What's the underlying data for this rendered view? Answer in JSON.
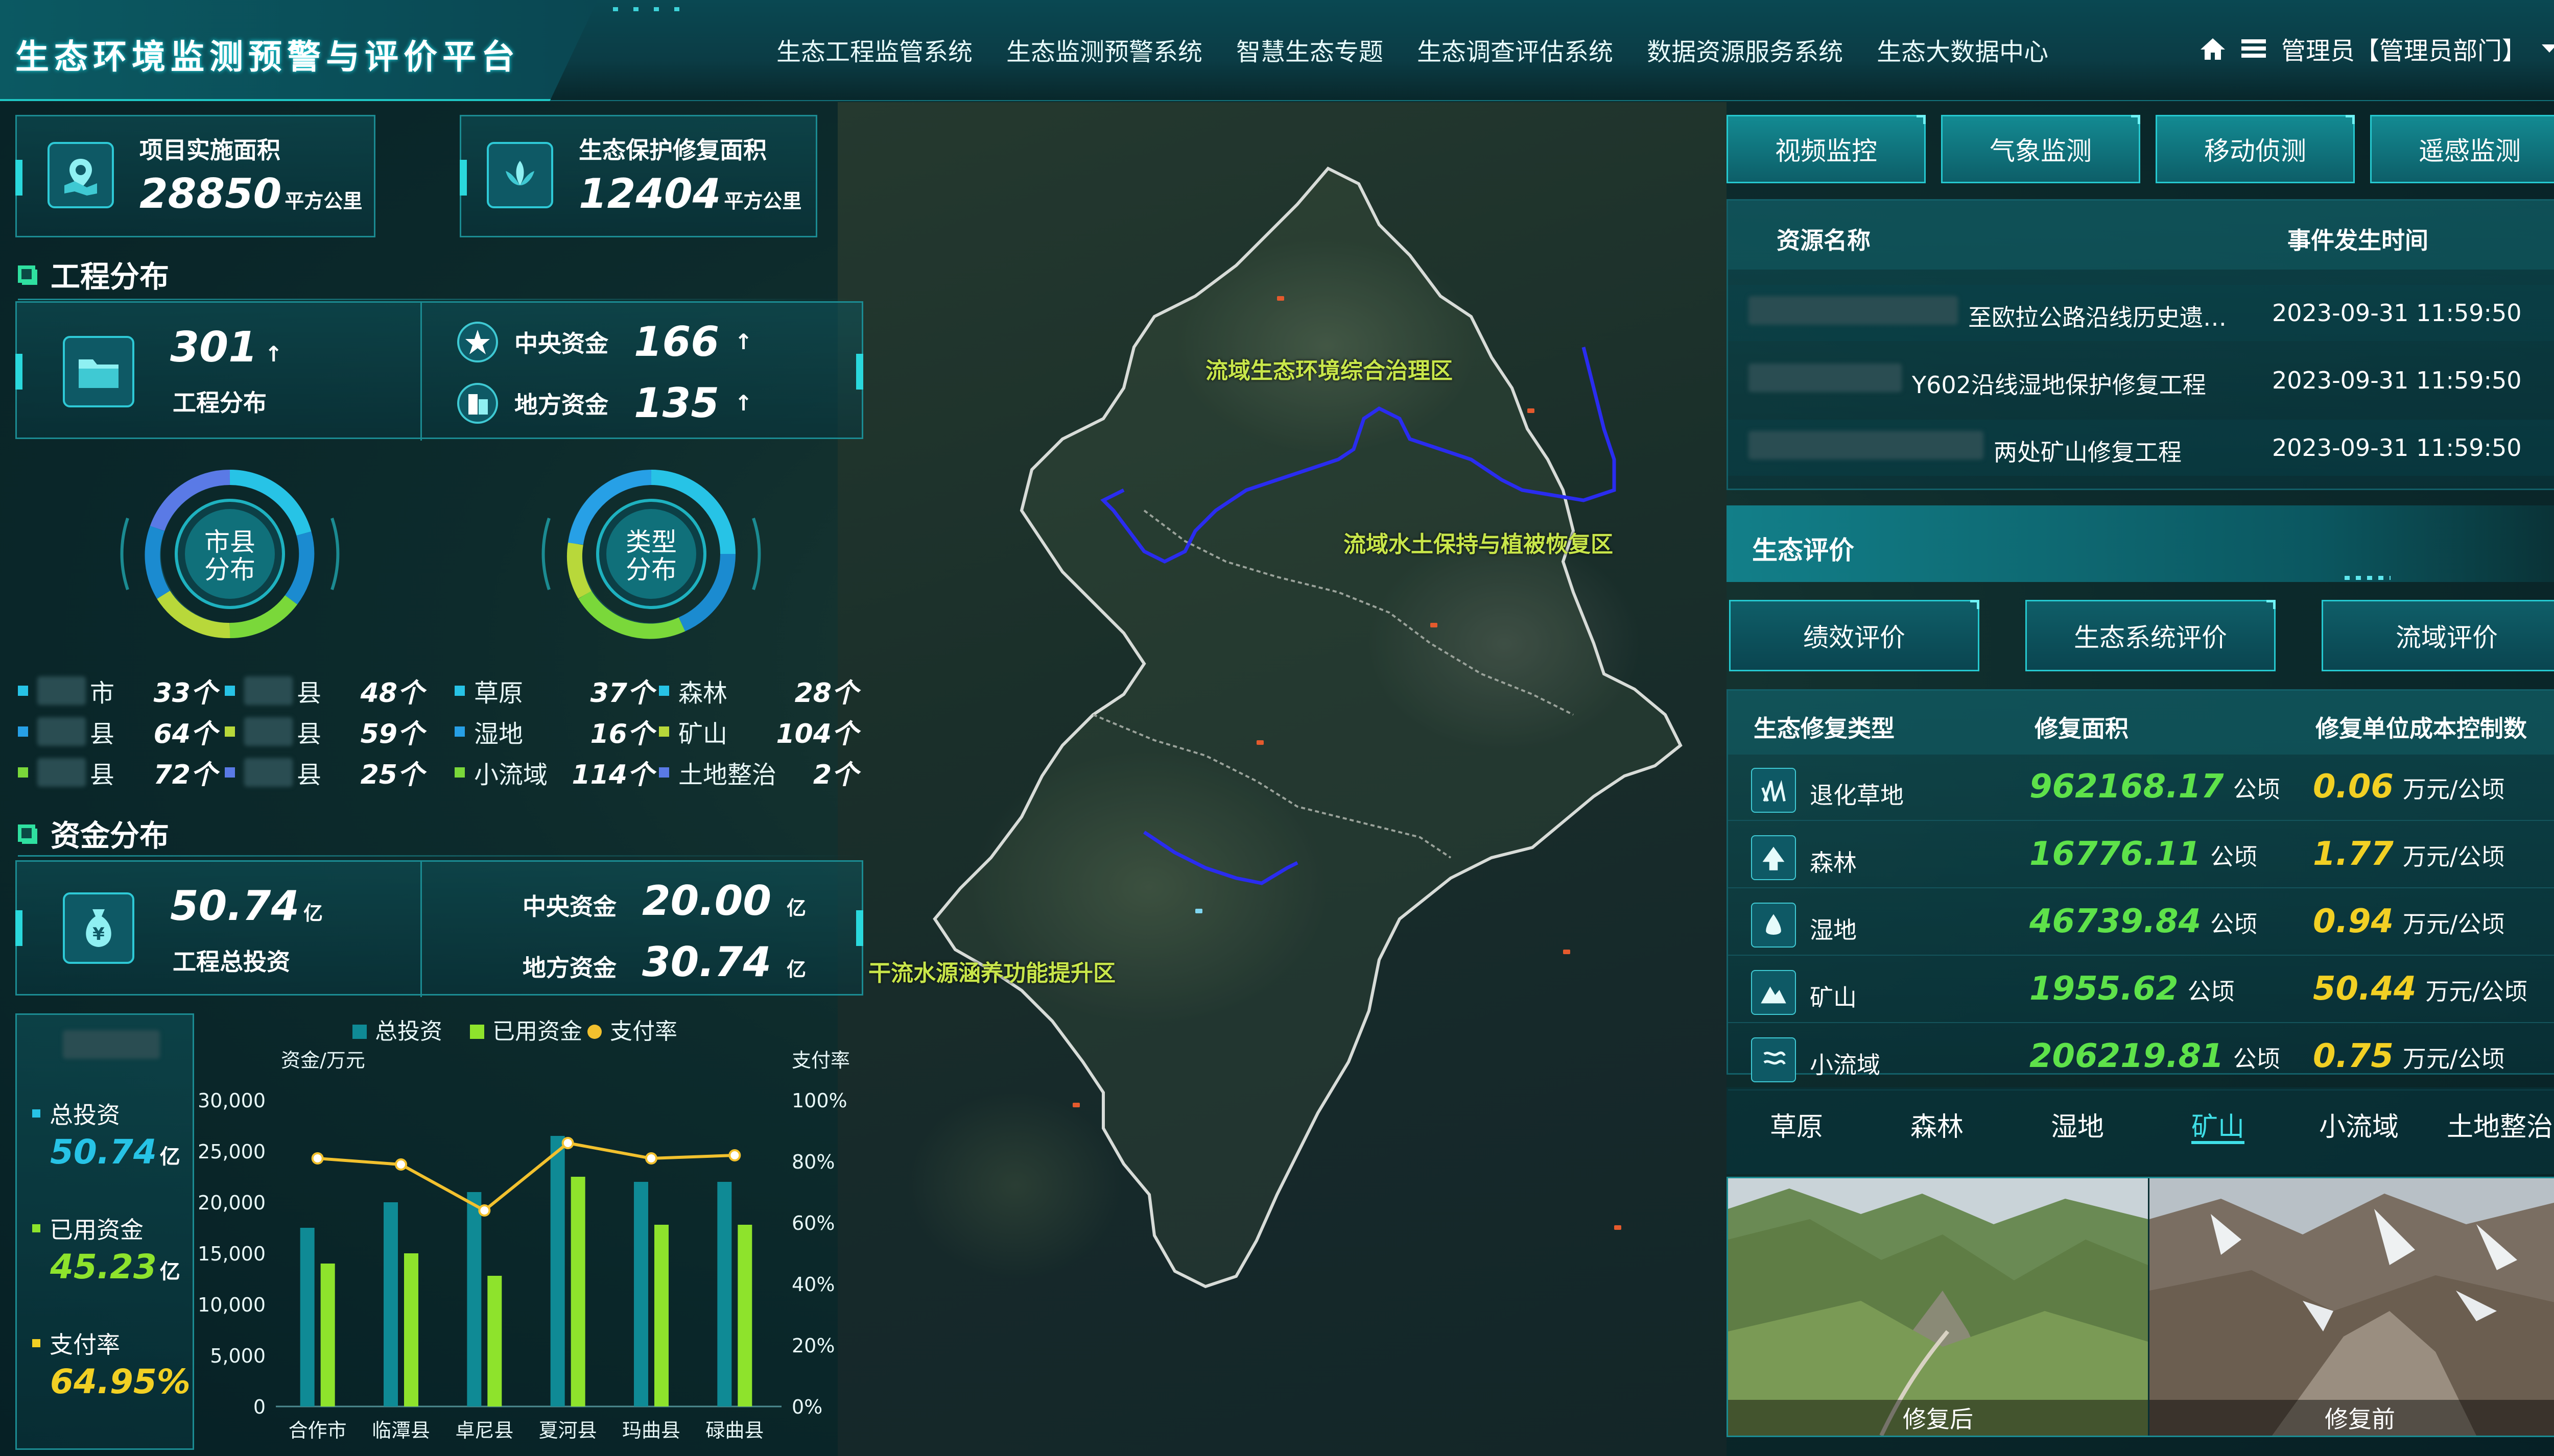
{
  "header": {
    "title": "生态环境监测预警与评价平台",
    "nav": [
      "生态工程监管系统",
      "生态监测预警系统",
      "智慧生态专题",
      "生态调查评估系统",
      "数据资源服务系统",
      "生态大数据中心"
    ],
    "user": "管理员【管理员部门】",
    "icons": [
      "home-icon",
      "menu-icon",
      "chevron-down-icon"
    ]
  },
  "stats": {
    "project_area": {
      "label": "项目实施面积",
      "value": "28850",
      "unit": "平方公里"
    },
    "restore_area": {
      "label": "生态保护修复面积",
      "value": "12404",
      "unit": "平方公里"
    }
  },
  "project": {
    "section_title": "工程分布",
    "total": "301",
    "total_label": "工程分布",
    "central_label": "中央资金",
    "central_value": "166",
    "local_label": "地方资金",
    "local_value": "135",
    "ring1_label": "市县\n分布",
    "ring2_label": "类型\n分布",
    "county_legend": [
      {
        "name": "市",
        "value": "33个",
        "color": "#27c3e6"
      },
      {
        "name": "县",
        "value": "64个",
        "color": "#27a0e6"
      },
      {
        "name": "县",
        "value": "72个",
        "color": "#7ad83a"
      },
      {
        "name": "县",
        "value": "48个",
        "color": "#27c3e6"
      },
      {
        "name": "县",
        "value": "59个",
        "color": "#b8d83a"
      },
      {
        "name": "县",
        "value": "25个",
        "color": "#5a7ae6"
      }
    ],
    "type_legend": [
      {
        "name": "草原",
        "value": "37个",
        "color": "#27c3e6"
      },
      {
        "name": "湿地",
        "value": "16个",
        "color": "#27a0e6"
      },
      {
        "name": "小流域",
        "value": "114个",
        "color": "#7ad83a"
      },
      {
        "name": "森林",
        "value": "28个",
        "color": "#27c3e6"
      },
      {
        "name": "矿山",
        "value": "104个",
        "color": "#b8d83a"
      },
      {
        "name": "土地整治",
        "value": "2个",
        "color": "#5a7ae6"
      }
    ]
  },
  "funds": {
    "section_title": "资金分布",
    "total": "50.74",
    "total_unit": "亿",
    "total_label": "工程总投资",
    "central_label": "中央资金",
    "central_value": "20.00",
    "local_label": "地方资金",
    "local_value": "30.74",
    "unit": "亿",
    "summary": [
      {
        "label": "总投资",
        "value": "50.74",
        "unit": "亿"
      },
      {
        "label": "已用资金",
        "value": "45.23",
        "unit": "亿"
      },
      {
        "label": "支付率",
        "value": "64.95%",
        "unit": ""
      }
    ]
  },
  "chart_data": {
    "type": "bar",
    "categories": [
      "合作市",
      "临潭县",
      "卓尼县",
      "夏河县",
      "玛曲县",
      "碌曲县"
    ],
    "series": [
      {
        "name": "总投资",
        "color": "#0f8a95",
        "values": [
          17500,
          20000,
          21000,
          26500,
          22000,
          22000
        ]
      },
      {
        "name": "已用资金",
        "color": "#8ee32c",
        "values": [
          14000,
          15000,
          12800,
          22500,
          17800,
          17800
        ]
      },
      {
        "name": "支付率",
        "color": "#f2c12e",
        "type": "line",
        "values": [
          81,
          79,
          64,
          86,
          81,
          82
        ]
      }
    ],
    "ylabel": "资金/万元",
    "ylabel_right": "支付率",
    "ylim": [
      0,
      30000
    ],
    "yticks": [
      "0",
      "5,000",
      "10,000",
      "15,000",
      "20,000",
      "25,000",
      "30,000"
    ],
    "ylim_right": [
      0,
      100
    ],
    "yticks_right": [
      "0%",
      "20%",
      "40%",
      "60%",
      "80%",
      "100%"
    ],
    "legend_position": "top"
  },
  "map": {
    "labels": [
      "流域生态环境综合治理区",
      "流域水土保持与植被恢复区",
      "干流水源涵养功能提升区"
    ]
  },
  "monitor": {
    "tabs": [
      "视频监控",
      "气象监测",
      "移动侦测",
      "遥感监测"
    ],
    "header": {
      "name": "资源名称",
      "time": "事件发生时间"
    },
    "rows": [
      {
        "name": "至欧拉公路沿线历史遗…",
        "time": "2023-09-31 11:59:50"
      },
      {
        "name": "Y602沿线湿地保护修复工程",
        "time": "2023-09-31 11:59:50"
      },
      {
        "name": "两处矿山修复工程",
        "time": "2023-09-31 11:59:50"
      }
    ]
  },
  "evaluation": {
    "title": "生态评价",
    "tabs": [
      "绩效评价",
      "生态系统评价",
      "流域评价"
    ],
    "header": {
      "type": "生态修复类型",
      "area": "修复面积",
      "cost": "修复单位成本控制数"
    },
    "rows": [
      {
        "type": "退化草地",
        "area": "962168.17",
        "area_unit": "公顷",
        "cost": "0.06",
        "cost_unit": "万元/公顷",
        "icon": "grass-icon"
      },
      {
        "type": "森林",
        "area": "16776.11",
        "area_unit": "公顷",
        "cost": "1.77",
        "cost_unit": "万元/公顷",
        "icon": "tree-icon"
      },
      {
        "type": "湿地",
        "area": "46739.84",
        "area_unit": "公顷",
        "cost": "0.94",
        "cost_unit": "万元/公顷",
        "icon": "water-drop-icon"
      },
      {
        "type": "矿山",
        "area": "1955.62",
        "area_unit": "公顷",
        "cost": "50.44",
        "cost_unit": "万元/公顷",
        "icon": "mountain-icon"
      },
      {
        "type": "小流域",
        "area": "206219.81",
        "area_unit": "公顷",
        "cost": "0.75",
        "cost_unit": "万元/公顷",
        "icon": "stream-icon"
      }
    ]
  },
  "categories": {
    "tabs": [
      "草原",
      "森林",
      "湿地",
      "矿山",
      "小流域",
      "土地整治"
    ],
    "active": "矿山"
  },
  "compare": {
    "after": "修复后",
    "before": "修复前"
  }
}
